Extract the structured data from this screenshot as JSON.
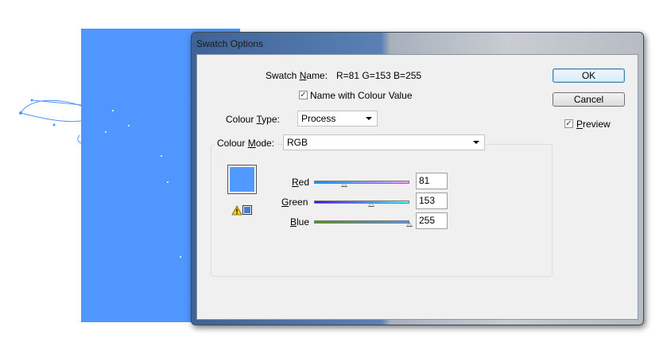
{
  "dialog": {
    "title": "Swatch Options"
  },
  "swatch_name": {
    "label": "Swatch Name:",
    "underline_char": "N",
    "value": "R=81 G=153 B=255"
  },
  "name_with_value": {
    "label": "Name with Colour Value",
    "checked": true
  },
  "colour_type": {
    "label": "Colour Type:",
    "value": "Process"
  },
  "colour_mode": {
    "label": "Colour Mode:",
    "value": "RGB"
  },
  "buttons": {
    "ok": "OK",
    "cancel": "Cancel"
  },
  "preview": {
    "label": "Preview",
    "checked": true
  },
  "swatch_color": "#5199ff",
  "channels": [
    {
      "label": "Red",
      "value": "81",
      "level": 0.318
    },
    {
      "label": "Green",
      "value": "153",
      "level": 0.6
    },
    {
      "label": "Blue",
      "value": "255",
      "level": 1.0
    }
  ],
  "colors": {
    "artboard": "#4f96fe",
    "accent": "#3c7fb1"
  }
}
